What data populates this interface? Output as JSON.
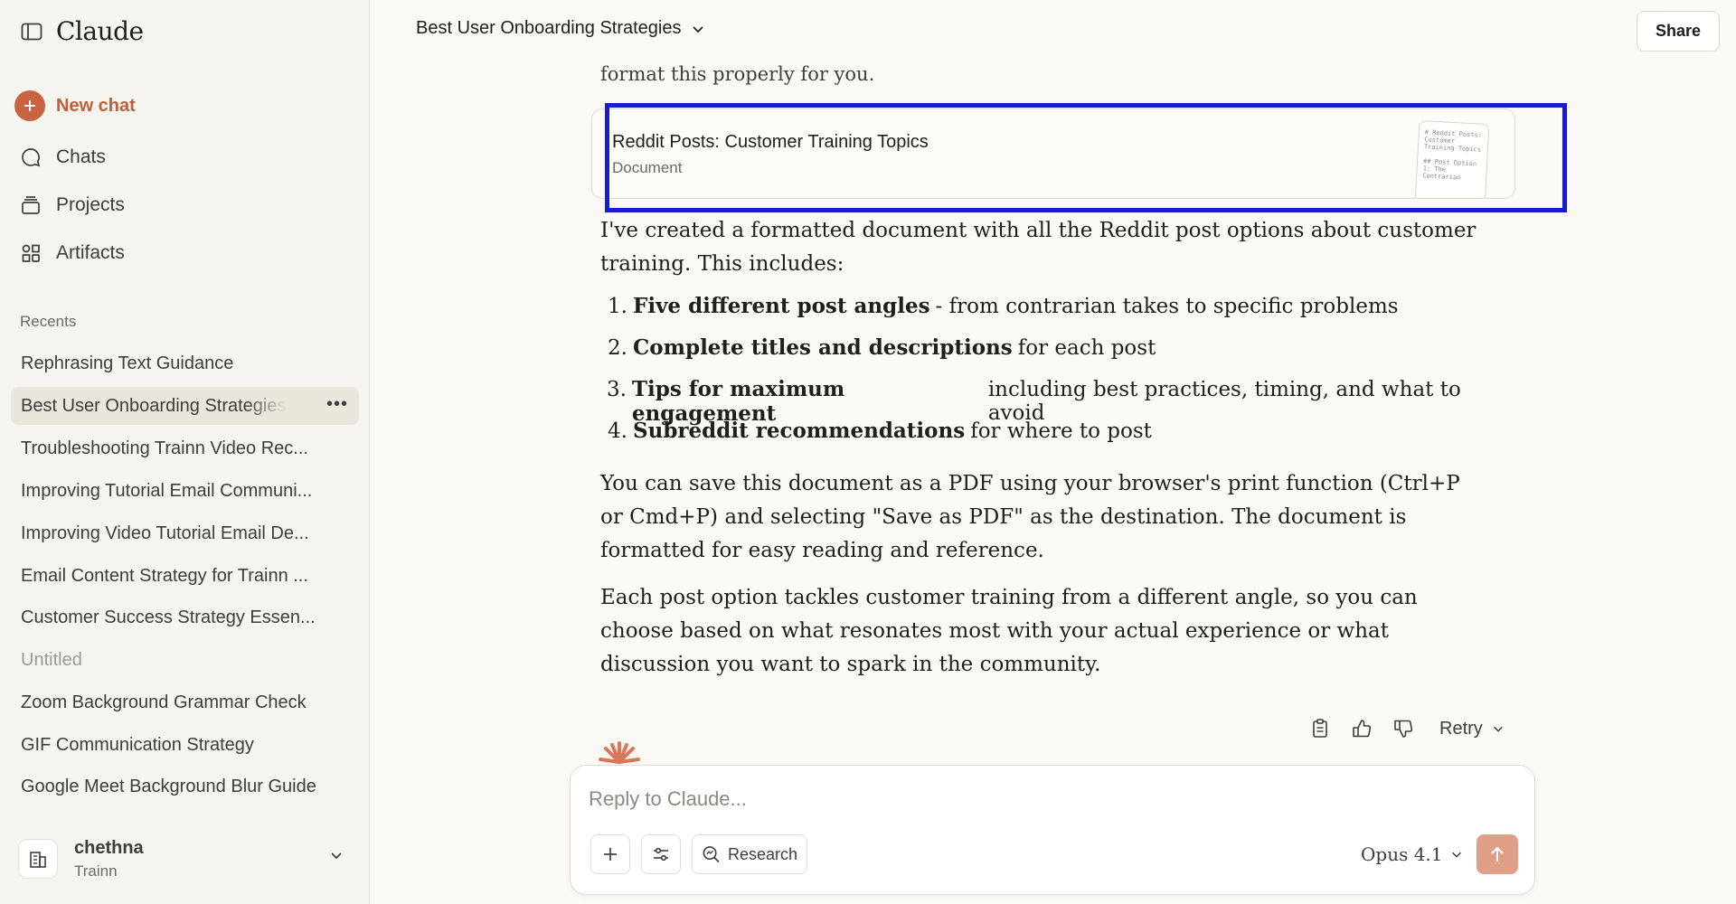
{
  "app": {
    "brand": "Claude"
  },
  "sidebar": {
    "new_chat": "New chat",
    "nav": [
      {
        "label": "Chats",
        "icon": "chat-bubble-icon"
      },
      {
        "label": "Projects",
        "icon": "folder-stack-icon"
      },
      {
        "label": "Artifacts",
        "icon": "artifacts-icon"
      }
    ],
    "recents_label": "Recents",
    "recents": [
      "Rephrasing Text Guidance",
      "Best User Onboarding Strategies",
      "Troubleshooting Trainn Video Rec...",
      "Improving Tutorial Email Communi...",
      "Improving Video Tutorial Email De...",
      "Email Content Strategy for Trainn ...",
      "Customer Success Strategy Essen...",
      "Untitled",
      "Zoom Background Grammar Check",
      "GIF Communication Strategy",
      "Google Meet Background Blur Guide"
    ],
    "user": {
      "name": "chethna",
      "org": "Trainn"
    }
  },
  "header": {
    "title": "Best User Onboarding Strategies",
    "share": "Share"
  },
  "message": {
    "lead_fragment": "format this properly for you.",
    "artifact": {
      "title": "Reddit Posts: Customer Training Topics",
      "type": "Document",
      "thumb": "# Reddit Posts: Customer Training Topics\n\n## Post Option 1: The Contrarian"
    },
    "intro": "I've created a formatted document with all the Reddit post options about customer training. This includes:",
    "list": [
      {
        "num": "1.",
        "bold": "Five different post angles",
        "rest": "- from contrarian takes to specific problems"
      },
      {
        "num": "2.",
        "bold": "Complete titles and descriptions",
        "rest": "for each post"
      },
      {
        "num": "3.",
        "bold": "Tips for maximum engagement",
        "rest": "including best practices, timing, and what to avoid"
      },
      {
        "num": "4.",
        "bold": "Subreddit recommendations",
        "rest": "for where to post"
      }
    ],
    "para2": "You can save this document as a PDF using your browser's print function (Ctrl+P or Cmd+P) and selecting \"Save as PDF\" as the destination. The document is formatted for easy reading and reference.",
    "para3": "Each post option tackles customer training from a different angle, so you can choose based on what resonates most with your actual experience or what discussion you want to spark in the community.",
    "retry": "Retry"
  },
  "composer": {
    "placeholder": "Reply to Claude...",
    "research": "Research",
    "model": "Opus 4.1"
  },
  "colors": {
    "accent": "#c96442",
    "highlight": "#1a1ad0",
    "send_disabled": "#e0a088"
  }
}
